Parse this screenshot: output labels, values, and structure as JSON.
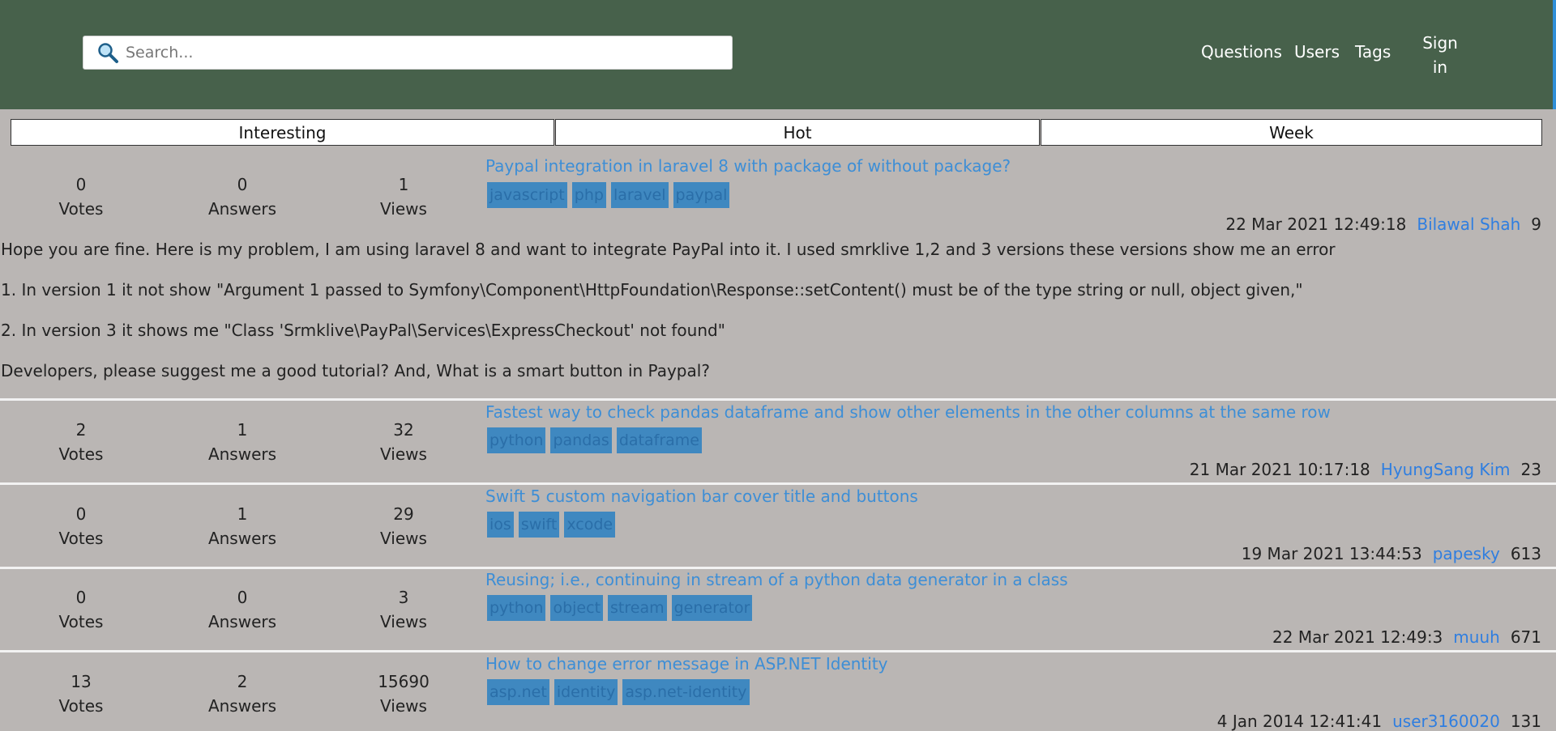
{
  "search": {
    "placeholder": "Search..."
  },
  "nav": {
    "questions": "Questions",
    "users": "Users",
    "tags": "Tags",
    "signin_line1": "Sign",
    "signin_line2": "in"
  },
  "tabs": [
    "Interesting",
    "Hot",
    "Week"
  ],
  "stat_labels": {
    "votes": "Votes",
    "answers": "Answers",
    "views": "Views"
  },
  "questions": [
    {
      "votes": "0",
      "answers": "0",
      "views": "1",
      "title": "Paypal integration in laravel 8 with package of without package?",
      "tags": [
        "javascript",
        "php",
        "laravel",
        "paypal"
      ],
      "date": "22 Mar 2021 12:49:18",
      "user": "Bilawal Shah",
      "rep": "9",
      "body": [
        "Hope you are fine. Here is my problem, I am using laravel 8 and want to integrate PayPal into it. I used smrklive 1,2 and 3 versions these versions show me an error",
        "1. In version 1 it not show \"Argument 1 passed to Symfony\\Component\\HttpFoundation\\Response::setContent() must be of the type string or null, object given,\"",
        "2. In version 3 it shows me \"Class 'Srmklive\\PayPal\\Services\\ExpressCheckout' not found\"",
        "Developers, please suggest me a good tutorial? And, What is a smart button in Paypal?"
      ]
    },
    {
      "votes": "2",
      "answers": "1",
      "views": "32",
      "title": "Fastest way to check pandas dataframe and show other elements in the other columns at the same row",
      "tags": [
        "python",
        "pandas",
        "dataframe"
      ],
      "date": "21 Mar 2021 10:17:18",
      "user": "HyungSang Kim",
      "rep": "23"
    },
    {
      "votes": "0",
      "answers": "1",
      "views": "29",
      "title": "Swift 5 custom navigation bar cover title and buttons",
      "tags": [
        "ios",
        "swift",
        "xcode"
      ],
      "date": "19 Mar 2021 13:44:53",
      "user": "papesky",
      "rep": "613"
    },
    {
      "votes": "0",
      "answers": "0",
      "views": "3",
      "title": "Reusing; i.e., continuing in stream of a python data generator in a class",
      "tags": [
        "python",
        "object",
        "stream",
        "generator"
      ],
      "date": "22 Mar 2021 12:49:3",
      "user": "muuh",
      "rep": "671"
    },
    {
      "votes": "13",
      "answers": "2",
      "views": "15690",
      "title": "How to change error message in ASP.NET Identity",
      "tags": [
        "asp.net",
        "identity",
        "asp.net-identity"
      ],
      "date": "4 Jan 2014 12:41:41",
      "user": "user3160020",
      "rep": "131"
    }
  ]
}
